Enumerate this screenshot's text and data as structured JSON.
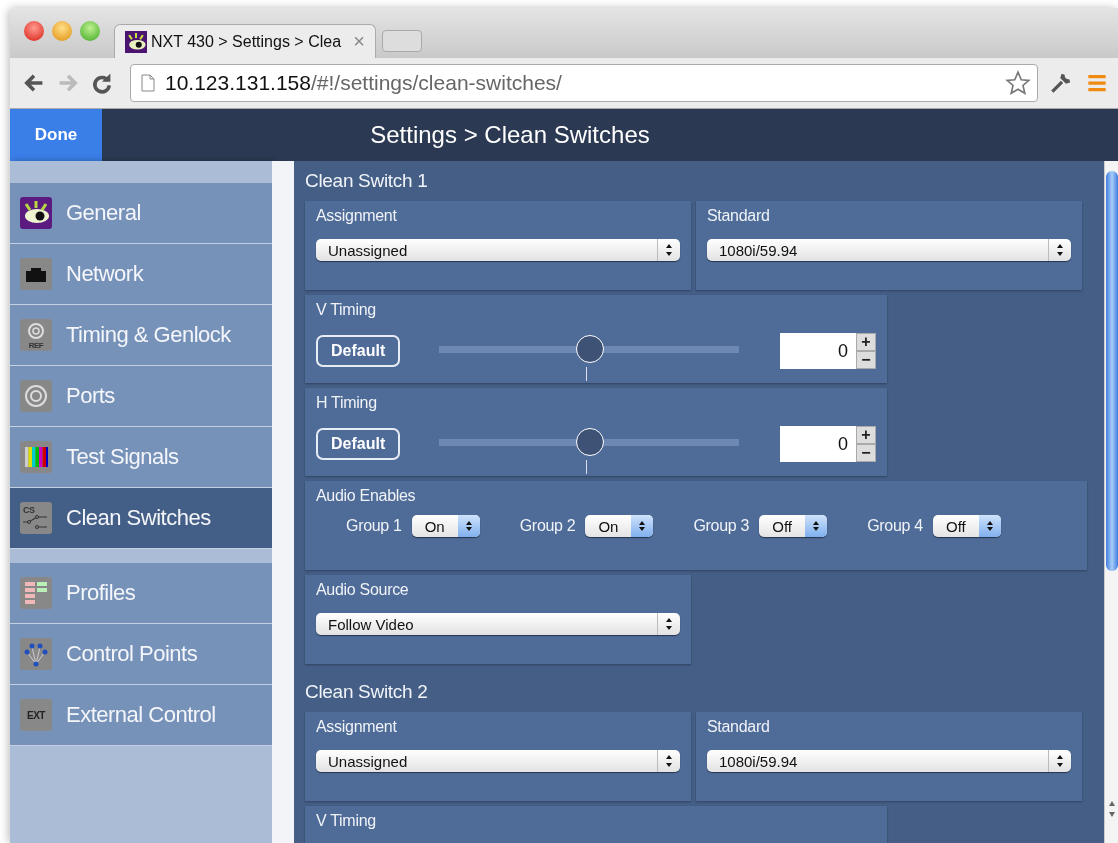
{
  "browser": {
    "tabs": [
      {
        "title": "NXT 430 > Settings > Clea",
        "close": "×",
        "selected": true
      }
    ],
    "navigation": {
      "back_disabled": false,
      "forward_disabled": true
    },
    "address": {
      "host": "10.123.131.158",
      "path": "/#!/settings/clean-switches/"
    }
  },
  "header": {
    "done_button": "Done",
    "title": "Settings > Clean Switches"
  },
  "sidebar": {
    "groups": [
      [
        {
          "label": "General",
          "selected": false
        },
        {
          "label": "Network",
          "selected": false
        },
        {
          "label": "Timing & Genlock",
          "icon_text": "REF",
          "selected": false
        },
        {
          "label": "Ports",
          "selected": false
        },
        {
          "label": "Test Signals",
          "selected": false
        },
        {
          "label": "Clean Switches",
          "icon_text": "CS",
          "selected": true
        }
      ],
      [
        {
          "label": "Profiles",
          "selected": false
        },
        {
          "label": "Control Points",
          "selected": false
        },
        {
          "label": "External Control",
          "icon_text": "EXT",
          "selected": false
        }
      ]
    ]
  },
  "sections": [
    {
      "title": "Clean Switch 1",
      "assignment": {
        "label": "Assignment",
        "value": "Unassigned"
      },
      "standard": {
        "label": "Standard",
        "value": "1080i/59.94"
      },
      "timings": [
        {
          "label": "V Timing",
          "button": "Default",
          "level": 0.5,
          "value": "0",
          "plus": "+",
          "minus": "−"
        },
        {
          "label": "H Timing",
          "button": "Default",
          "level": 0.5,
          "value": "0",
          "plus": "+",
          "minus": "−"
        }
      ],
      "audio_enables": {
        "label": "Audio Enables",
        "groups": [
          {
            "label": "Group 1",
            "value": "On"
          },
          {
            "label": "Group 2",
            "value": "On"
          },
          {
            "label": "Group 3",
            "value": "Off"
          },
          {
            "label": "Group 4",
            "value": "Off"
          }
        ]
      },
      "audio_source": {
        "label": "Audio Source",
        "value": "Follow Video"
      }
    },
    {
      "title": "Clean Switch 2",
      "assignment": {
        "label": "Assignment",
        "value": "Unassigned"
      },
      "standard": {
        "label": "Standard",
        "value": "1080i/59.94"
      },
      "timings": [
        {
          "label": "V Timing"
        }
      ]
    }
  ]
}
